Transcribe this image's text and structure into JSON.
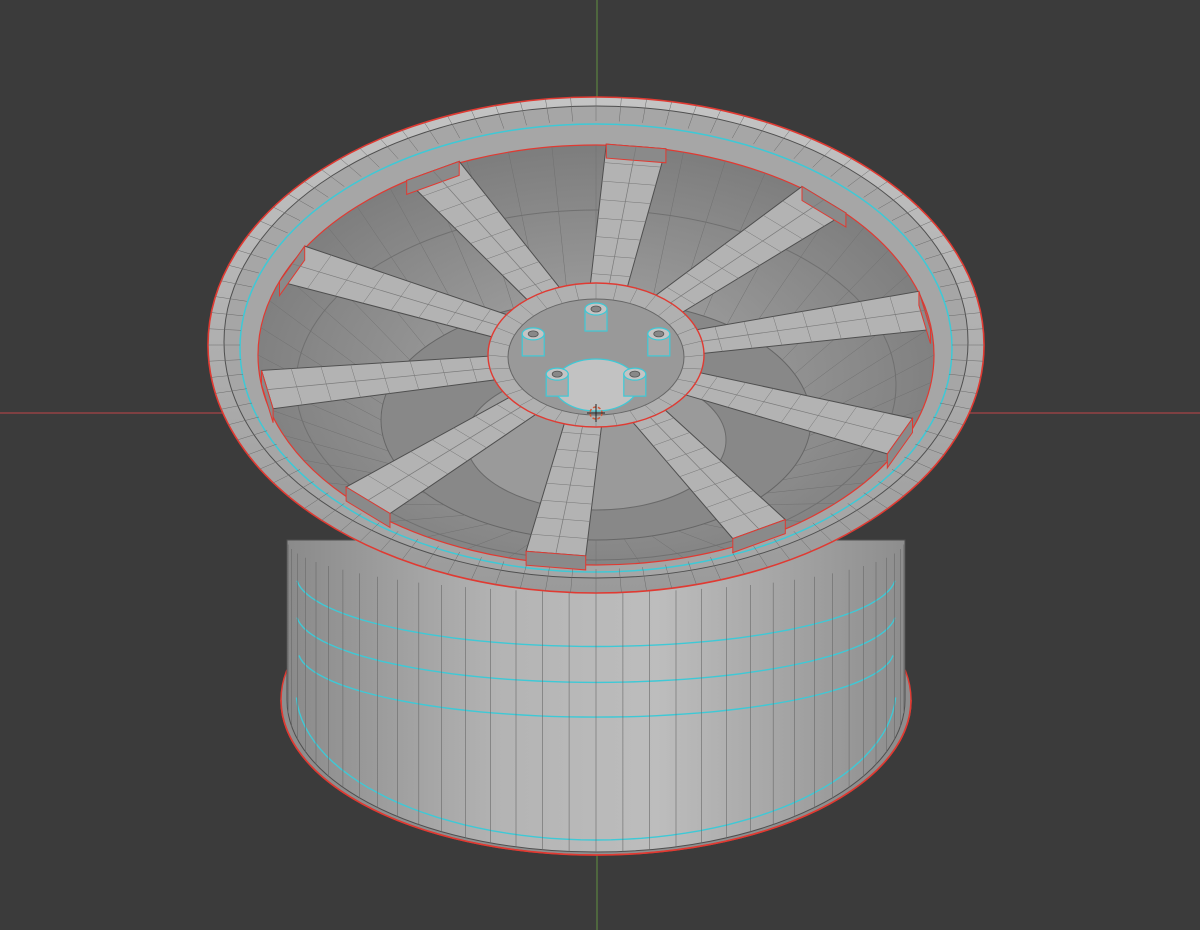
{
  "viewport": {
    "background_color": "#3b3b3b",
    "object": "wheel-rim",
    "shading": "solid-gray-wireframe",
    "spoke_count": 10,
    "lug_nut_count": 5,
    "colors": {
      "surface": "#b7b7b7",
      "surface_dark": "#8f8f8f",
      "surface_darker": "#6f6f6f",
      "edge": "#4f4f4f",
      "seam_red": "#e03a32",
      "crease_cyan": "#3ec9d6",
      "axis_x": "#b8484a",
      "axis_y": "#5f8a3f"
    },
    "icons": {
      "origin": "3d-cursor-icon"
    }
  }
}
